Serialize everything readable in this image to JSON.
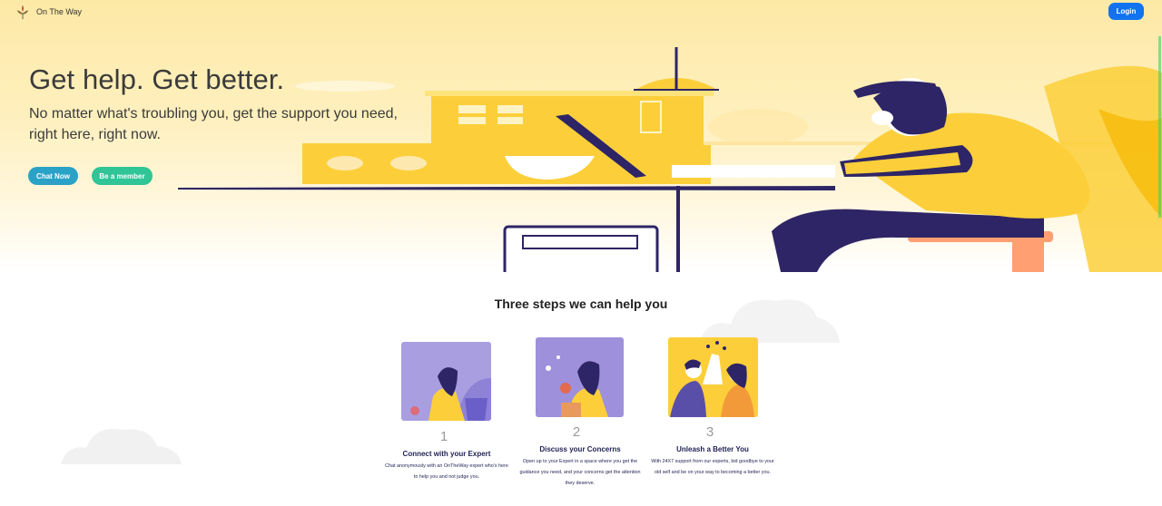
{
  "nav": {
    "brand": "On The Way",
    "login_label": "Login"
  },
  "hero": {
    "title": "Get help. Get better.",
    "subtitle": "No matter what's troubling you, get the support you need, right here, right now.",
    "chat_label": "Chat Now",
    "member_label": "Be a member"
  },
  "steps": {
    "heading": "Three steps we can help you",
    "items": [
      {
        "number": "1",
        "title": "Connect with your Expert",
        "description": "Chat anonymously with an OnTheWay expert who's here to help you and not judge you."
      },
      {
        "number": "2",
        "title": "Discuss your Concerns",
        "description": "Open up to your Expert in a space where you get the guidance you need, and your concerns get the attention they deserve."
      },
      {
        "number": "3",
        "title": "Unleash a Better You",
        "description": "With 24X7 support from our experts, bid goodbye to your old self and be on your way to becoming a better you."
      }
    ]
  },
  "colors": {
    "login": "#1173f0",
    "chat": "#2aa2c8",
    "member": "#2fc596",
    "accent_yellow": "#fccf3a",
    "navy": "#2e2566"
  }
}
